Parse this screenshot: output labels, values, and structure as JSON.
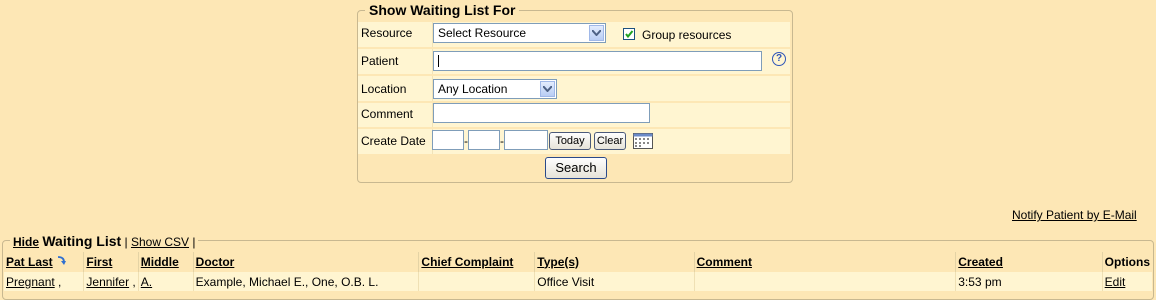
{
  "search_form": {
    "legend": "Show Waiting List For",
    "resource": {
      "label": "Resource",
      "value": "Select Resource"
    },
    "group_resources": {
      "label": "Group resources",
      "checked": true
    },
    "patient": {
      "label": "Patient",
      "value": ""
    },
    "location": {
      "label": "Location",
      "value": "Any Location"
    },
    "comment": {
      "label": "Comment",
      "value": ""
    },
    "create_date": {
      "label": "Create Date",
      "month": "",
      "day": "",
      "year": "",
      "today_label": "Today",
      "clear_label": "Clear"
    },
    "search_label": "Search"
  },
  "notify_link": "Notify Patient by E-Mail",
  "waiting_list": {
    "hide_label": "Hide",
    "title": "Waiting List",
    "show_csv_label": "Show CSV",
    "columns": [
      "Pat Last",
      "First",
      "Middle",
      "Doctor",
      "Chief Complaint",
      "Type(s)",
      "Comment",
      "Created",
      "Options"
    ],
    "rows": [
      {
        "last": "Pregnant",
        "first": "Jennifer",
        "middle": "A.",
        "doctor": "Example, Michael E., One, O.B. L.",
        "complaint": "",
        "types": "Office Visit",
        "comment": "",
        "created": "3:53 pm",
        "options": "Edit"
      }
    ]
  }
}
